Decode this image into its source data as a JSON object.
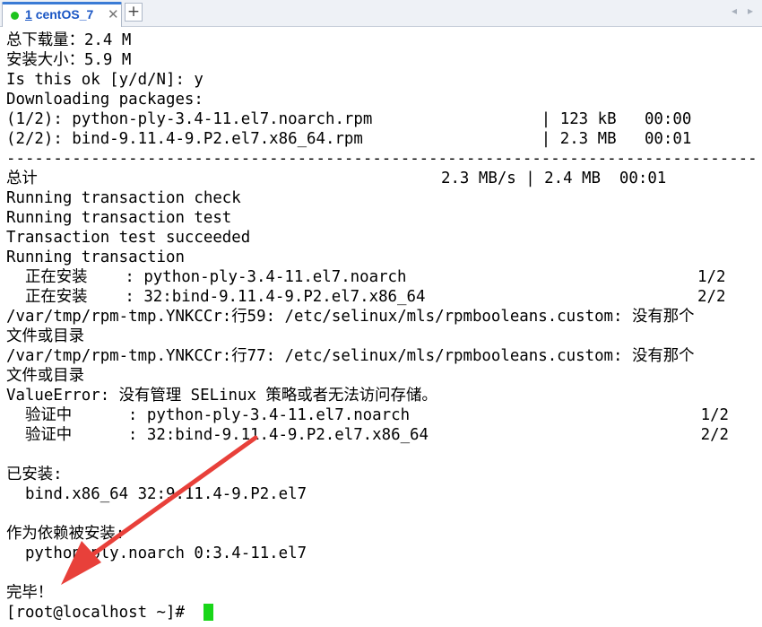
{
  "tab": {
    "number": "1",
    "title": "centOS_7",
    "close_glyph": "✕",
    "add_glyph": "+",
    "status_color": "#1ec41e"
  },
  "nav": {
    "prev_glyph": "◂",
    "next_glyph": "▸"
  },
  "terminal": {
    "lines": [
      "总下载量：2.4 M",
      "安装大小：5.9 M",
      "Is this ok [y/d/N]: y",
      "Downloading packages:",
      "(1/2): python-ply-3.4-11.el7.noarch.rpm                  | 123 kB   00:00",
      "(2/2): bind-9.11.4-9.P2.el7.x86_64.rpm                   | 2.3 MB   00:01",
      "--------------------------------------------------------------------------------",
      "总计                                           2.3 MB/s | 2.4 MB  00:01",
      "Running transaction check",
      "Running transaction test",
      "Transaction test succeeded",
      "Running transaction",
      "  正在安装    : python-ply-3.4-11.el7.noarch                               1/2",
      "  正在安装    : 32:bind-9.11.4-9.P2.el7.x86_64                             2/2",
      "/var/tmp/rpm-tmp.YNKCCr:行59: /etc/selinux/mls/rpmbooleans.custom: 没有那个",
      "文件或目录",
      "/var/tmp/rpm-tmp.YNKCCr:行77: /etc/selinux/mls/rpmbooleans.custom: 没有那个",
      "文件或目录",
      "ValueError: 没有管理 SELinux 策略或者无法访问存储。",
      "  验证中      : python-ply-3.4-11.el7.noarch                               1/2",
      "  验证中      : 32:bind-9.11.4-9.P2.el7.x86_64                             2/2",
      "",
      "已安装:",
      "  bind.x86_64 32:9.11.4-9.P2.el7",
      "",
      "作为依赖被安装:",
      "  python-ply.noarch 0:3.4-11.el7",
      "",
      "完毕！",
      "[root@localhost ~]# "
    ]
  },
  "colors": {
    "text": "#000000",
    "background": "#ffffff",
    "cursor": "#19d619",
    "annotation_arrow": "#e8403a",
    "tab_accent": "#1a56c4"
  }
}
